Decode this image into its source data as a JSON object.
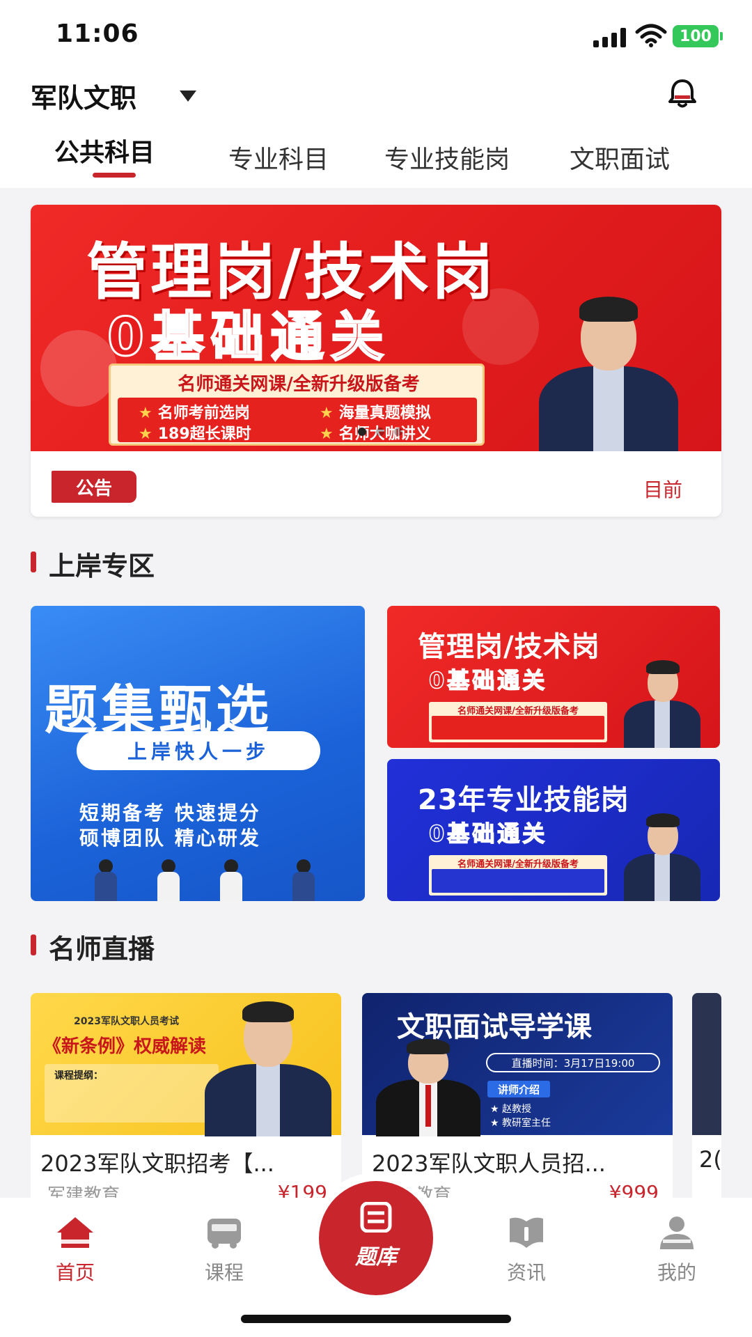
{
  "status_bar": {
    "time": "11:06",
    "battery": "100"
  },
  "header": {
    "region": "军队文职"
  },
  "tabs": [
    {
      "label": "公共科目",
      "active": true
    },
    {
      "label": "专业科目",
      "active": false
    },
    {
      "label": "专业技能岗",
      "active": false
    },
    {
      "label": "文职面试",
      "active": false
    }
  ],
  "banner": {
    "title": "管理岗/技术岗",
    "subtitle": "0基础通关",
    "box_title": "名师通关网课/全新升级版备考",
    "bullets": [
      "名师考前选岗",
      "海量真题模拟",
      "189超长课时",
      "名师大咖讲义"
    ],
    "notice_tag": "公告",
    "notice_text": "目前"
  },
  "section_landing": {
    "title": "上岸专区",
    "tile_blue": {
      "title": "题集甄选",
      "pill": "上岸快人一步",
      "line1": "短期备考 快速提分",
      "line2": "硕博团队 精心研发"
    },
    "tile_red": {
      "title": "管理岗/技术岗",
      "subtitle": "0基础通关",
      "box_title": "名师通关网课/全新升级版备考"
    },
    "tile_blue2": {
      "title": "23年专业技能岗",
      "subtitle": "0基础通关",
      "box_title": "名师通关网课/全新升级版备考"
    }
  },
  "section_live": {
    "title": "名师直播",
    "cards": [
      {
        "img_small": "2023军队文职人员考试",
        "img_title": "《新条例》权威解读",
        "img_note": "课程提纲：",
        "title": "2023军队文职招考【...",
        "org": "军建教育",
        "price": "¥199"
      },
      {
        "img_title": "文职面试导学课",
        "img_time": "直播时间：3月17日19:00",
        "img_teacher_tag": "讲师介绍",
        "img_teacher_1": "★ 赵教授",
        "img_teacher_2": "★ 教研室主任",
        "title": "2023军队文职人员招...",
        "org": "军建教育",
        "price": "¥999"
      },
      {
        "title": "2(",
        "org": ""
      }
    ]
  },
  "bottom_nav": {
    "items": [
      {
        "label": "首页",
        "active": true
      },
      {
        "label": "课程",
        "active": false
      },
      {
        "label": "资讯",
        "active": false
      },
      {
        "label": "我的",
        "active": false
      }
    ],
    "center": {
      "label": "题库"
    }
  },
  "colors": {
    "brand_red": "#c8252d",
    "blue": "#1b62d8",
    "nav_gray": "#888888"
  },
  "icons": [
    "signal-icon",
    "wifi-icon",
    "battery-icon",
    "caret-down-icon",
    "bell-icon",
    "home-icon",
    "bus-icon",
    "question-bank-icon",
    "book-heart-icon",
    "user-icon"
  ]
}
